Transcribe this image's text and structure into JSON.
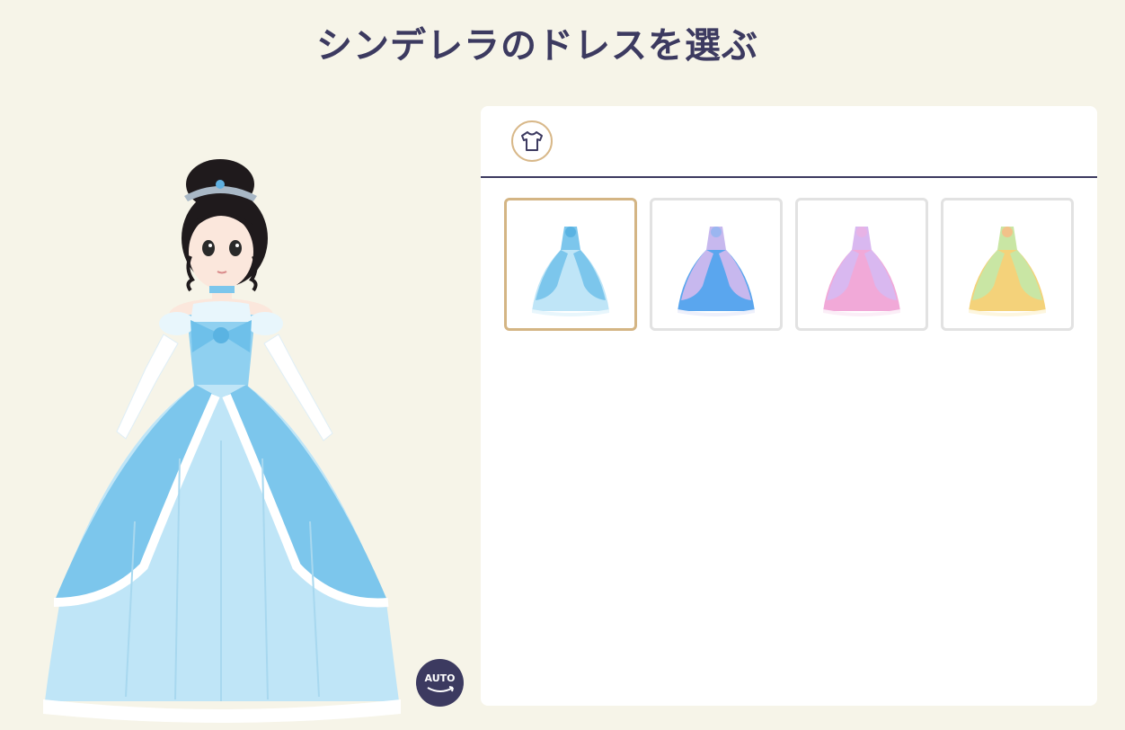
{
  "page": {
    "title": "シンデレラのドレスを選ぶ"
  },
  "preview": {
    "auto_rotate_label": "AUTO"
  },
  "category_tabs": [
    {
      "icon": "shirt-icon",
      "active": true
    }
  ],
  "dresses": [
    {
      "icon": "dress-blue-thumbnail",
      "selected": true,
      "colors": [
        "#7cc6ec",
        "#bfe5f7",
        "#e8f6fc"
      ]
    },
    {
      "icon": "dress-bluepurple-thumbnail",
      "selected": false,
      "colors": [
        "#5aa6ee",
        "#c7b8ee",
        "#eef0fb"
      ]
    },
    {
      "icon": "dress-pink-thumbnail",
      "selected": false,
      "colors": [
        "#f1a9d8",
        "#d9b8f0",
        "#fbeef7"
      ]
    },
    {
      "icon": "dress-yellow-thumbnail",
      "selected": false,
      "colors": [
        "#f4d27a",
        "#c9e6a4",
        "#fdf6df"
      ]
    }
  ],
  "colors": {
    "accent": "#3c3a60",
    "selected_border": "#d4b584",
    "background": "#f6f4e8"
  }
}
